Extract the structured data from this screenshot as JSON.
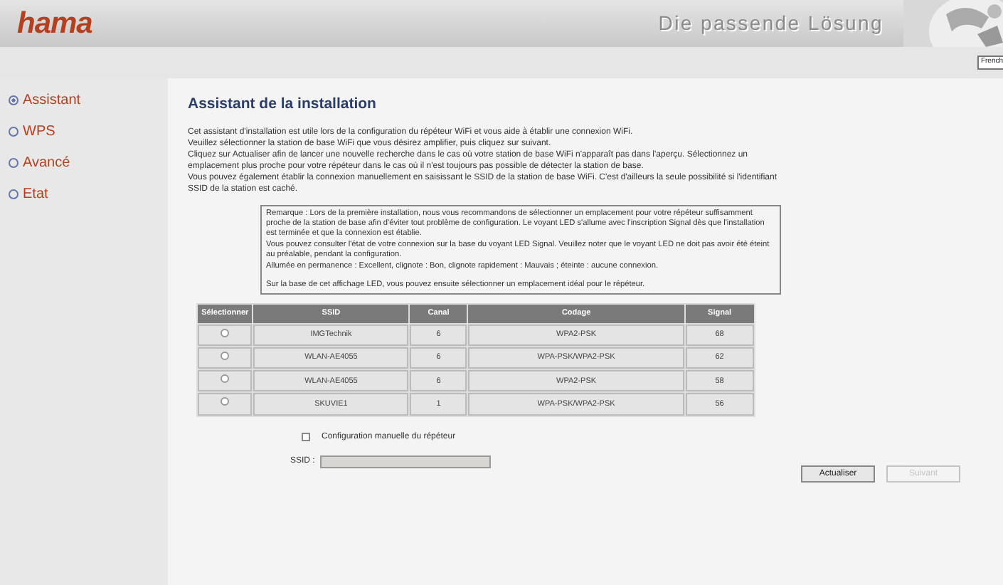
{
  "header": {
    "logo": "hama",
    "slogan": "Die passende Lösung",
    "language": "French"
  },
  "sidebar": {
    "items": [
      {
        "label": "Assistant",
        "selected": true
      },
      {
        "label": "WPS",
        "selected": false
      },
      {
        "label": "Avancé",
        "selected": false
      },
      {
        "label": "Etat",
        "selected": false
      }
    ]
  },
  "title": "Assistant de la installation",
  "intro": [
    "Cet assistant d'installation est utile lors de la configuration du répéteur WiFi et vous aide à établir une connexion WiFi.",
    "Veuillez sélectionner la station de base WiFi que vous désirez amplifier, puis cliquez sur suivant.",
    "Cliquez sur Actualiser afin de lancer une nouvelle recherche dans le cas où votre station de base WiFi n'apparaît pas dans l'aperçu. Sélectionnez un emplacement plus proche pour votre répéteur dans le cas où il n'est toujours pas possible de détecter la station de base.",
    "Vous pouvez également établir la connexion manuellement en saisissant le SSID de la station de base WiFi. C'est d'ailleurs la seule possibilité si l'identifiant SSID de la station est caché."
  ],
  "remark": [
    "Remarque : Lors de la première installation, nous vous recommandons de sélectionner un emplacement pour votre répéteur suffisamment proche de la station de base afin d'éviter tout problème de configuration. Le voyant LED s'allume avec l'inscription Signal dès que l'installation est terminée et que la connexion est établie.",
    "Vous pouvez consulter l'état de votre connexion sur la base du voyant LED Signal. Veuillez noter que le voyant LED ne doit pas avoir été éteint au préalable, pendant la configuration.",
    "Allumée en permanence : Excellent, clignote : Bon, clignote rapidement : Mauvais ; éteinte : aucune connexion.",
    "Sur la base de cet affichage LED, vous pouvez ensuite sélectionner un emplacement idéal pour le répéteur."
  ],
  "table": {
    "columns": [
      "Sélectionner",
      "SSID",
      "Canal",
      "Codage",
      "Signal"
    ],
    "rows": [
      {
        "selected": false,
        "ssid": "IMGTechnik",
        "canal": "6",
        "codage": "WPA2-PSK",
        "signal": "68"
      },
      {
        "selected": false,
        "ssid": "WLAN-AE4055",
        "canal": "6",
        "codage": "WPA-PSK/WPA2-PSK",
        "signal": "62"
      },
      {
        "selected": false,
        "ssid": "WLAN-AE4055",
        "canal": "6",
        "codage": "WPA2-PSK",
        "signal": "58"
      },
      {
        "selected": false,
        "ssid": "SKUVIE1",
        "canal": "1",
        "codage": "WPA-PSK/WPA2-PSK",
        "signal": "56"
      }
    ]
  },
  "manual": {
    "label": "Configuration manuelle du répéteur",
    "checked": false
  },
  "ssid_field": {
    "label": "SSID :",
    "disabled": true
  },
  "buttons": [
    {
      "label": "Actualiser",
      "disabled": false
    },
    {
      "label": "Suivant",
      "disabled": true
    }
  ]
}
